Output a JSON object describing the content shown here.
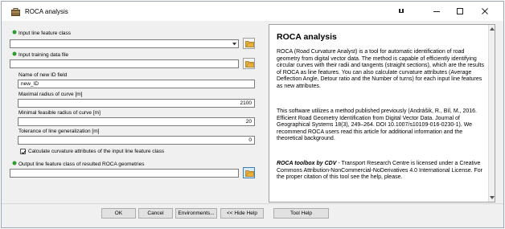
{
  "window": {
    "title": "ROCA analysis",
    "controls": [
      "pin-icon",
      "minimize-icon",
      "maximize-icon",
      "close-icon"
    ]
  },
  "form": {
    "input_line": {
      "label": "Input line feature class",
      "value": ""
    },
    "input_training": {
      "label": "Input training data file",
      "value": ""
    },
    "id_field": {
      "label": "Name of new ID field",
      "value": "new_ID"
    },
    "max_radius": {
      "label": "Maximal radius of curve [m]",
      "value": "2100"
    },
    "min_radius": {
      "label": "Minimal feasible radius of curve [m]",
      "value": "20"
    },
    "tolerance": {
      "label": "Tolerance of line generalization [m]",
      "value": "0"
    },
    "calc_attrs": {
      "label": "Calculate curvature attributes of the input line feature class",
      "checked": true
    },
    "output_line": {
      "label": "Output line feature class of resulted ROCA geometries",
      "value": ""
    }
  },
  "help": {
    "title": "ROCA analysis",
    "p1": "ROCA (Road Curvature Analyst) is a tool for automatic identification of road geometry from digital vector data. The method is capable of efficiently identifying circular curves with their radii and tangents (straight sections), which are the results of ROCA as line features. You can also calculate curvature attributes (Average Deflection Angle, Detour ratio and the Number of turns) for each input line features as new attributes.",
    "p2": "This software utilizes a method published previously (Andrášik, R., Bíl, M., 2016. Efficient Road Geometry Identification from Digital Vector Data. Journal of Geographical Systems 18(3), 249–264. DOI 10.1007/s10109-016-0230-1). We recommend ROCA users read this article for additional information and the theoretical background.",
    "p3_emph": "ROCA toolbox by CDV",
    "p3_rest": " - Transport Research Centre is licensed under a Creative Commons Attribution-NonCommercial-NoDerivatives 4.0 International License. For the proper citation of this tool see the help, please."
  },
  "buttons": {
    "ok": "OK",
    "cancel": "Cancel",
    "environments": "Environments...",
    "hide_help": "<< Hide Help",
    "tool_help": "Tool Help"
  },
  "colors": {
    "required_dot": "#2e9b2e",
    "folder": "#e8b23c",
    "window_bg": "#f0f0f0"
  }
}
